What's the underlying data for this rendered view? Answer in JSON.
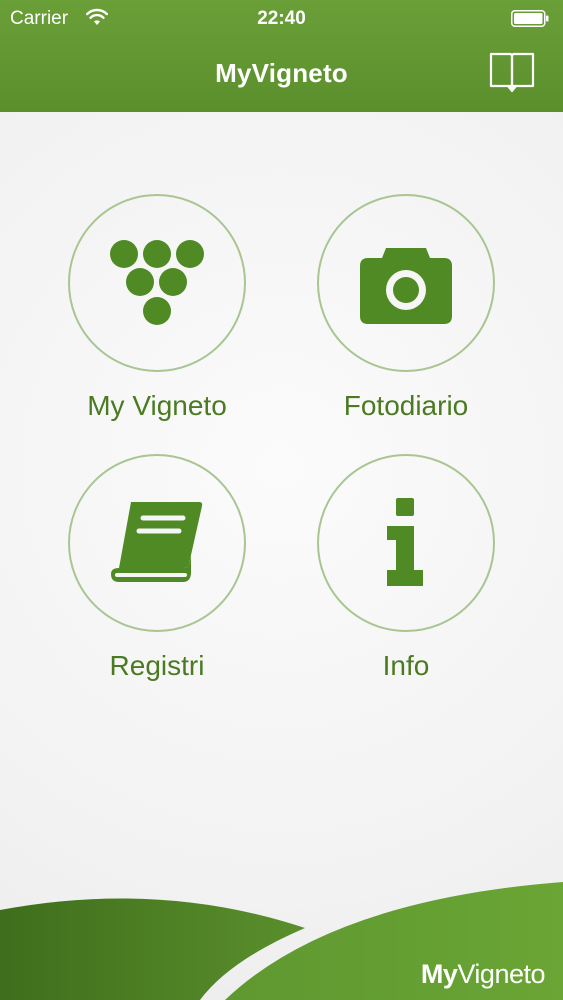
{
  "status_bar": {
    "carrier": "Carrier",
    "time": "22:40"
  },
  "nav": {
    "title": "MyVigneto",
    "book_icon": "book-icon"
  },
  "menu": {
    "items": [
      {
        "label": "My Vigneto",
        "icon": "grapes-icon"
      },
      {
        "label": "Fotodiario",
        "icon": "camera-icon"
      },
      {
        "label": "Registri",
        "icon": "book-icon"
      },
      {
        "label": "Info",
        "icon": "info-icon"
      }
    ]
  },
  "footer": {
    "logo_my": "My",
    "logo_rest": "Vigneto"
  },
  "colors": {
    "brand_green": "#5a8f2c",
    "icon_green": "#4f8a24",
    "circle_border": "#a9c591",
    "label_green": "#4b7a22"
  }
}
